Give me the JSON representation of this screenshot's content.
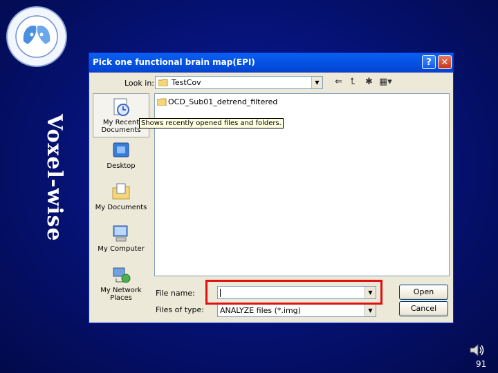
{
  "slide": {
    "vertical_title": "Voxel-wise",
    "page_number": "91"
  },
  "dialog": {
    "title": "Pick one functional brain map(EPI)",
    "help_button": "?",
    "close_button": "✕",
    "look_in_label": "Look in:",
    "look_in_value": "TestCov",
    "places": [
      {
        "label": "My Recent Documents",
        "icon": "recent-documents-icon"
      },
      {
        "label": "Desktop",
        "icon": "desktop-icon"
      },
      {
        "label": "My Documents",
        "icon": "my-documents-icon"
      },
      {
        "label": "My Computer",
        "icon": "my-computer-icon"
      },
      {
        "label": "My Network Places",
        "icon": "network-places-icon"
      }
    ],
    "files": [
      {
        "name": "OCD_Sub01_detrend_filtered",
        "type": "folder"
      }
    ],
    "tooltip": "Shows recently opened files and folders.",
    "file_name_label": "File name:",
    "file_name_value": "",
    "file_type_label": "Files of type:",
    "file_type_value": "ANALYZE files (*.img)",
    "open_button": "Open",
    "cancel_button": "Cancel"
  },
  "colors": {
    "background": "#06137a",
    "titlebar": "#0450e0",
    "highlight": "#e01010"
  }
}
